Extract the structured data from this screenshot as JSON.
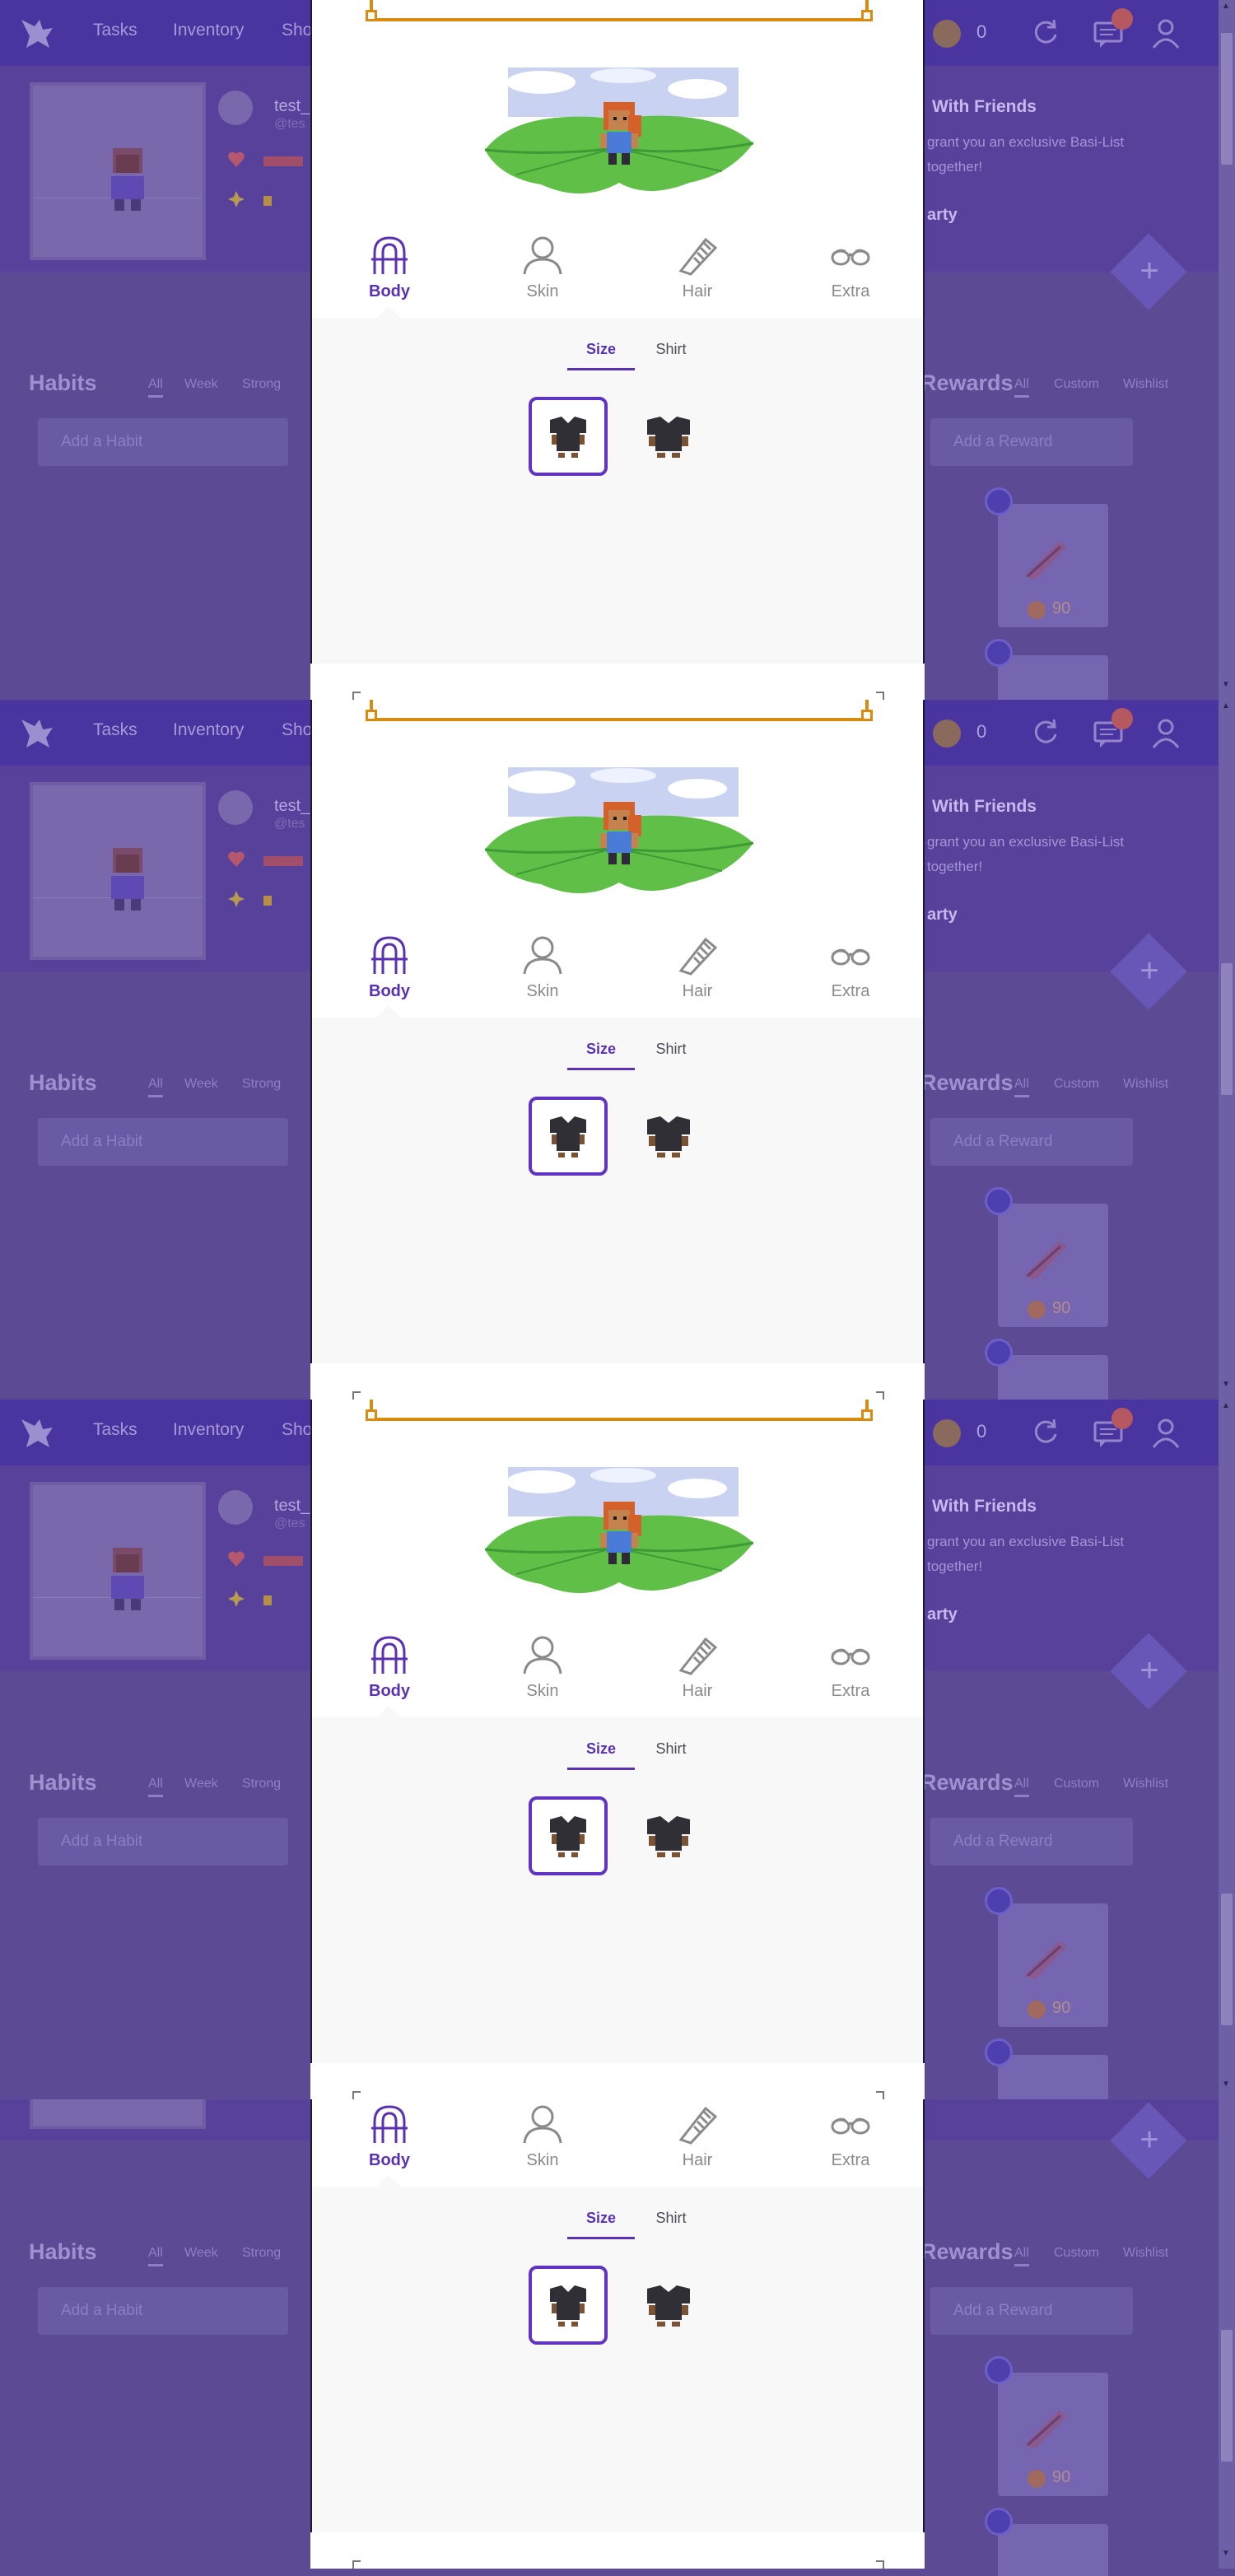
{
  "app": {
    "nav": {
      "tasks": "Tasks",
      "inventory": "Inventory",
      "shops": "Sho"
    },
    "gem_count": "0",
    "user": {
      "name": "test_",
      "handle": "@tes"
    },
    "party": {
      "title": "With Friends",
      "text": "grant you an exclusive Basi-List together!",
      "button": "arty"
    },
    "habits": {
      "title": "Habits",
      "tabs": [
        "All",
        "Week",
        "Strong"
      ],
      "add_placeholder": "Add a Habit"
    },
    "rewards": {
      "title": "Rewards",
      "tabs": [
        "All",
        "Custom",
        "Wishlist"
      ],
      "add_placeholder": "Add a Reward",
      "price": "90"
    },
    "plus": "+"
  },
  "modal": {
    "categories": [
      {
        "label": "Body",
        "icon": "body-icon",
        "active": true
      },
      {
        "label": "Skin",
        "icon": "skin-icon",
        "active": false
      },
      {
        "label": "Hair",
        "icon": "hair-comb-icon",
        "active": false
      },
      {
        "label": "Extra",
        "icon": "glasses-icon",
        "active": false
      }
    ],
    "subtabs": [
      {
        "label": "Size",
        "active": true
      },
      {
        "label": "Shirt",
        "active": false
      }
    ],
    "size_options": [
      {
        "name": "slim-shirt-option",
        "selected": true
      },
      {
        "name": "broad-shirt-option",
        "selected": false
      }
    ]
  },
  "colors": {
    "accent": "#5a31b0",
    "gold": "#d88b11",
    "overlay": "#5d4a94"
  }
}
